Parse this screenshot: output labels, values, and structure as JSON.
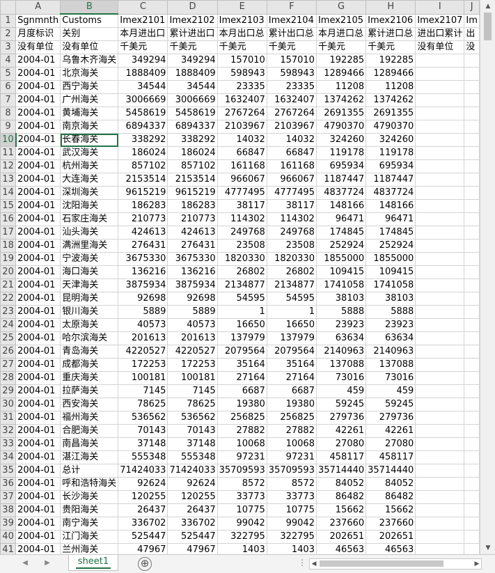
{
  "columns": [
    "A",
    "B",
    "C",
    "D",
    "E",
    "F",
    "G",
    "H",
    "I",
    "J"
  ],
  "selected_column": "B",
  "selected_row": 10,
  "rows": [
    [
      "1",
      "Sgnmnth",
      "Customs",
      "Imex2101",
      "Imex2102",
      "Imex2103",
      "Imex2104",
      "Imex2105",
      "Imex2106",
      "Imex2107",
      "Im"
    ],
    [
      "2",
      "月度标识",
      "关别",
      "本月进出口",
      "累计进出口",
      "本月出口总",
      "累计出口总",
      "本月进口总",
      "累计进口总",
      "进出口累计",
      "出"
    ],
    [
      "3",
      "没有单位",
      "没有单位",
      "千美元",
      "千美元",
      "千美元",
      "千美元",
      "千美元",
      "千美元",
      "没有单位",
      "没"
    ],
    [
      "4",
      "2004-01",
      "乌鲁木齐海关",
      "349294",
      "349294",
      "157010",
      "157010",
      "192285",
      "192285",
      "",
      ""
    ],
    [
      "5",
      "2004-01",
      "北京海关",
      "1888409",
      "1888409",
      "598943",
      "598943",
      "1289466",
      "1289466",
      "",
      ""
    ],
    [
      "6",
      "2004-01",
      "西宁海关",
      "34544",
      "34544",
      "23335",
      "23335",
      "11208",
      "11208",
      "",
      ""
    ],
    [
      "7",
      "2004-01",
      "广州海关",
      "3006669",
      "3006669",
      "1632407",
      "1632407",
      "1374262",
      "1374262",
      "",
      ""
    ],
    [
      "8",
      "2004-01",
      "黄埔海关",
      "5458619",
      "5458619",
      "2767264",
      "2767264",
      "2691355",
      "2691355",
      "",
      ""
    ],
    [
      "9",
      "2004-01",
      "南京海关",
      "6894337",
      "6894337",
      "2103967",
      "2103967",
      "4790370",
      "4790370",
      "",
      ""
    ],
    [
      "10",
      "2004-01",
      "长春海关",
      "338292",
      "338292",
      "14032",
      "14032",
      "324260",
      "324260",
      "",
      ""
    ],
    [
      "11",
      "2004-01",
      "武汉海关",
      "186024",
      "186024",
      "66847",
      "66847",
      "119178",
      "119178",
      "",
      ""
    ],
    [
      "12",
      "2004-01",
      "杭州海关",
      "857102",
      "857102",
      "161168",
      "161168",
      "695934",
      "695934",
      "",
      ""
    ],
    [
      "13",
      "2004-01",
      "大连海关",
      "2153514",
      "2153514",
      "966067",
      "966067",
      "1187447",
      "1187447",
      "",
      ""
    ],
    [
      "14",
      "2004-01",
      "深圳海关",
      "9615219",
      "9615219",
      "4777495",
      "4777495",
      "4837724",
      "4837724",
      "",
      ""
    ],
    [
      "15",
      "2004-01",
      "沈阳海关",
      "186283",
      "186283",
      "38117",
      "38117",
      "148166",
      "148166",
      "",
      ""
    ],
    [
      "16",
      "2004-01",
      "石家庄海关",
      "210773",
      "210773",
      "114302",
      "114302",
      "96471",
      "96471",
      "",
      ""
    ],
    [
      "17",
      "2004-01",
      "汕头海关",
      "424613",
      "424613",
      "249768",
      "249768",
      "174845",
      "174845",
      "",
      ""
    ],
    [
      "18",
      "2004-01",
      "满洲里海关",
      "276431",
      "276431",
      "23508",
      "23508",
      "252924",
      "252924",
      "",
      ""
    ],
    [
      "19",
      "2004-01",
      "宁波海关",
      "3675330",
      "3675330",
      "1820330",
      "1820330",
      "1855000",
      "1855000",
      "",
      ""
    ],
    [
      "20",
      "2004-01",
      "海口海关",
      "136216",
      "136216",
      "26802",
      "26802",
      "109415",
      "109415",
      "",
      ""
    ],
    [
      "21",
      "2004-01",
      "天津海关",
      "3875934",
      "3875934",
      "2134877",
      "2134877",
      "1741058",
      "1741058",
      "",
      ""
    ],
    [
      "22",
      "2004-01",
      "昆明海关",
      "92698",
      "92698",
      "54595",
      "54595",
      "38103",
      "38103",
      "",
      ""
    ],
    [
      "23",
      "2004-01",
      "银川海关",
      "5889",
      "5889",
      "1",
      "1",
      "5888",
      "5888",
      "",
      ""
    ],
    [
      "24",
      "2004-01",
      "太原海关",
      "40573",
      "40573",
      "16650",
      "16650",
      "23923",
      "23923",
      "",
      ""
    ],
    [
      "25",
      "2004-01",
      "哈尔滨海关",
      "201613",
      "201613",
      "137979",
      "137979",
      "63634",
      "63634",
      "",
      ""
    ],
    [
      "26",
      "2004-01",
      "青岛海关",
      "4220527",
      "4220527",
      "2079564",
      "2079564",
      "2140963",
      "2140963",
      "",
      ""
    ],
    [
      "27",
      "2004-01",
      "成都海关",
      "172253",
      "172253",
      "35164",
      "35164",
      "137088",
      "137088",
      "",
      ""
    ],
    [
      "28",
      "2004-01",
      "重庆海关",
      "100181",
      "100181",
      "27164",
      "27164",
      "73016",
      "73016",
      "",
      ""
    ],
    [
      "29",
      "2004-01",
      "拉萨海关",
      "7145",
      "7145",
      "6687",
      "6687",
      "459",
      "459",
      "",
      ""
    ],
    [
      "30",
      "2004-01",
      "西安海关",
      "78625",
      "78625",
      "19380",
      "19380",
      "59245",
      "59245",
      "",
      ""
    ],
    [
      "31",
      "2004-01",
      "福州海关",
      "536562",
      "536562",
      "256825",
      "256825",
      "279736",
      "279736",
      "",
      ""
    ],
    [
      "32",
      "2004-01",
      "合肥海关",
      "70143",
      "70143",
      "27882",
      "27882",
      "42261",
      "42261",
      "",
      ""
    ],
    [
      "33",
      "2004-01",
      "南昌海关",
      "37148",
      "37148",
      "10068",
      "10068",
      "27080",
      "27080",
      "",
      ""
    ],
    [
      "34",
      "2004-01",
      "湛江海关",
      "555348",
      "555348",
      "97231",
      "97231",
      "458117",
      "458117",
      "",
      ""
    ],
    [
      "35",
      "2004-01",
      "总计",
      "71424033",
      "71424033",
      "35709593",
      "35709593",
      "35714440",
      "35714440",
      "",
      ""
    ],
    [
      "36",
      "2004-01",
      "呼和浩特海关",
      "92624",
      "92624",
      "8572",
      "8572",
      "84052",
      "84052",
      "",
      ""
    ],
    [
      "37",
      "2004-01",
      "长沙海关",
      "120255",
      "120255",
      "33773",
      "33773",
      "86482",
      "86482",
      "",
      ""
    ],
    [
      "38",
      "2004-01",
      "贵阳海关",
      "26437",
      "26437",
      "10775",
      "10775",
      "15662",
      "15662",
      "",
      ""
    ],
    [
      "39",
      "2004-01",
      "南宁海关",
      "336702",
      "336702",
      "99042",
      "99042",
      "237660",
      "237660",
      "",
      ""
    ],
    [
      "40",
      "2004-01",
      "江门海关",
      "525447",
      "525447",
      "322795",
      "322795",
      "202651",
      "202651",
      "",
      ""
    ],
    [
      "41",
      "2004-01",
      "兰州海关",
      "47967",
      "47967",
      "1403",
      "1403",
      "46563",
      "46563",
      "",
      ""
    ]
  ],
  "sheet_tabs": [
    "sheet1"
  ],
  "add_sheet_label": "⊕",
  "accent_color": "#217346",
  "icons": {
    "first-sheet": "◀",
    "last-sheet": "▶",
    "scroll-up": "▲",
    "scroll-down": "▼",
    "scroll-left": "◀",
    "scroll-right": "▶"
  }
}
